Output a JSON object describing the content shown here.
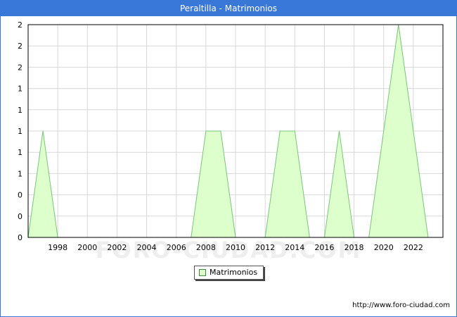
{
  "window": {
    "title": "Peraltilla - Matrimonios"
  },
  "watermark": "FORO-CIUDAD.COM",
  "source": "http://www.foro-ciudad.com",
  "colors": {
    "title_bar": "#3a78d8",
    "area_fill": "#ddffcc",
    "area_line": "#7bc47b",
    "grid": "#d8d8d8"
  },
  "chart_data": {
    "type": "area",
    "title": "Peraltilla - Matrimonios",
    "xlabel": "",
    "ylabel": "",
    "x": [
      1996,
      1997,
      1998,
      1999,
      2000,
      2001,
      2002,
      2003,
      2004,
      2005,
      2006,
      2007,
      2008,
      2009,
      2010,
      2011,
      2012,
      2013,
      2014,
      2015,
      2016,
      2017,
      2018,
      2019,
      2020,
      2021,
      2022,
      2023
    ],
    "xticks": [
      "1998",
      "2000",
      "2002",
      "2004",
      "2006",
      "2008",
      "2010",
      "2012",
      "2014",
      "2016",
      "2018",
      "2020",
      "2022"
    ],
    "xtick_values": [
      1998,
      2000,
      2002,
      2004,
      2006,
      2008,
      2010,
      2012,
      2014,
      2016,
      2018,
      2020,
      2022
    ],
    "yticks": [
      "0",
      "0",
      "0",
      "1",
      "1",
      "1",
      "1",
      "1",
      "2",
      "2",
      "2"
    ],
    "xlim": [
      1996,
      2024
    ],
    "ylim": [
      0,
      2
    ],
    "grid": true,
    "legend_position": "bottom-center",
    "series": [
      {
        "name": "Matrimonios",
        "values": [
          0,
          1,
          0,
          0,
          0,
          0,
          0,
          0,
          0,
          0,
          0,
          0,
          1,
          1,
          0,
          0,
          0,
          1,
          1,
          0,
          0,
          1,
          0,
          0,
          1,
          2,
          1,
          0
        ]
      }
    ]
  }
}
